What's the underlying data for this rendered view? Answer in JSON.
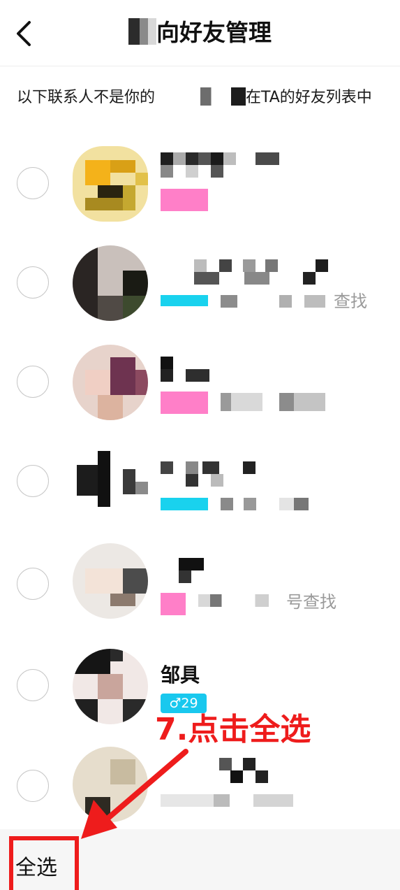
{
  "header": {
    "title": "向好友管理",
    "back_icon": "chevron-left-icon"
  },
  "notice": {
    "before": "以下联系人不是你的",
    "after": "在TA的好友列表中"
  },
  "contacts": [
    {
      "sub_text": ""
    },
    {
      "sub_text": "查找"
    },
    {
      "sub_text": ""
    },
    {
      "sub_text": ""
    },
    {
      "sub_text": "号查找"
    },
    {
      "name": "邹具",
      "age_badge": "♂29"
    },
    {
      "sub_text": ""
    }
  ],
  "footer": {
    "select_all": "全选"
  },
  "annotation": {
    "label": "7.点击全选",
    "color": "#ee1c1c"
  }
}
